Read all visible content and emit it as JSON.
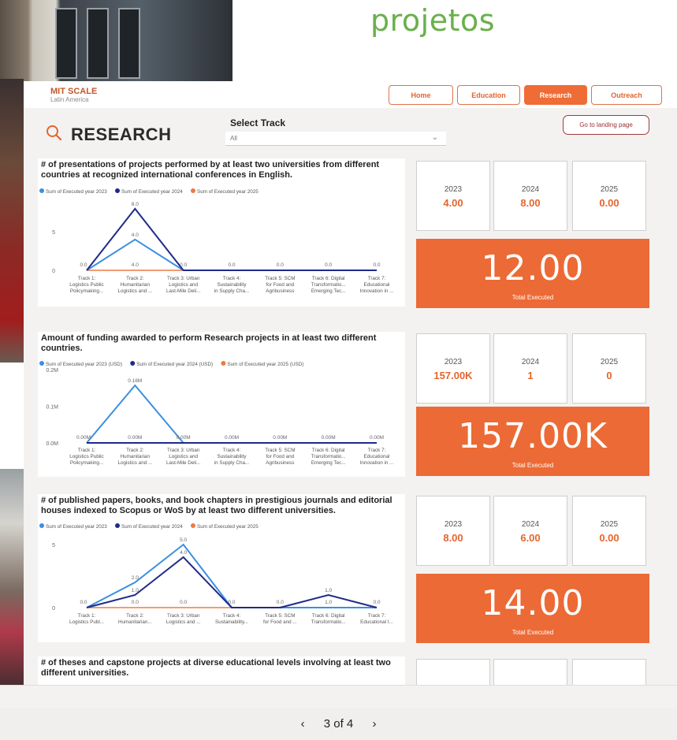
{
  "headline": "projetos",
  "app": {
    "brand_name": "MIT SCALE",
    "brand_sub": "Latin America"
  },
  "nav": {
    "tabs": [
      {
        "label": "Home",
        "active": false
      },
      {
        "label": "Education",
        "active": false
      },
      {
        "label": "Research",
        "active": true
      },
      {
        "label": "Outreach",
        "active": false
      }
    ]
  },
  "page": {
    "title": "RESEARCH",
    "track_label": "Select Track",
    "track_value": "All",
    "landing_button": "Go to landing page"
  },
  "colors": {
    "accent": "#ec6a35",
    "series_2023": "#3b8fe0",
    "series_2024": "#1f2a8a",
    "series_2025": "#ef7a45"
  },
  "categories": [
    [
      "Track 1:",
      "Logistics Public",
      "Policymaking..."
    ],
    [
      "Track 2:",
      "Humanitarian",
      "Logistics and ..."
    ],
    [
      "Track 3: Urban",
      "Logistics and",
      "Last-Mile Deli..."
    ],
    [
      "Track 4:",
      "Sustainability",
      "in Supply Cha..."
    ],
    [
      "Track 5: SCM",
      "for Food and",
      "Agribusiness"
    ],
    [
      "Track 6: Digital",
      "Transformatio...",
      "Emerging Tec..."
    ],
    [
      "Track 7:",
      "Educational",
      "Innovation in ..."
    ]
  ],
  "categories_short": [
    [
      "Track 1:",
      "Logistics Publ..."
    ],
    [
      "Track 2:",
      "Humanitarian..."
    ],
    [
      "Track 3: Urban",
      "Logistics and ..."
    ],
    [
      "Track 4:",
      "Sustainability..."
    ],
    [
      "Track 5: SCM",
      "for Food and ..."
    ],
    [
      "Track 6: Digital",
      "Transformatio..."
    ],
    [
      "Track 7:",
      "Educational I..."
    ]
  ],
  "chart_data": [
    {
      "type": "line",
      "title": "# of presentations of projects performed by at least two universities from different countries at recognized international conferences in English.",
      "categories": [
        "Track 1: Logistics Public Policymaking...",
        "Track 2: Humanitarian Logistics and ...",
        "Track 3: Urban Logistics and Last-Mile Deli...",
        "Track 4: Sustainability in Supply Cha...",
        "Track 5: SCM for Food and Agribusiness",
        "Track 6: Digital Transformatio... Emerging Tec...",
        "Track 7: Educational Innovation in ..."
      ],
      "series": [
        {
          "name": "Sum of Executed year 2023",
          "values": [
            0,
            4,
            0,
            0,
            0,
            0,
            0
          ]
        },
        {
          "name": "Sum of Executed year 2024",
          "values": [
            0,
            8,
            0,
            0,
            0,
            0,
            0
          ]
        },
        {
          "name": "Sum of Executed year 2025",
          "values": [
            0,
            0,
            0,
            0,
            0,
            0,
            0
          ]
        }
      ],
      "data_labels": [
        "0.0",
        "4.0",
        "0.0",
        "0.0",
        "0.0",
        "0.0",
        "0.0"
      ],
      "peak_label": "8.0",
      "yticks": [
        "5",
        "0"
      ],
      "ylim": [
        0,
        8.5
      ],
      "years": [
        {
          "year": "2023",
          "value": "4.00"
        },
        {
          "year": "2024",
          "value": "8.00"
        },
        {
          "year": "2025",
          "value": "0.00"
        }
      ],
      "total": "12.00",
      "total_label": "Total Executed"
    },
    {
      "type": "line",
      "title": "Amount of funding awarded to perform Research projects in at least two different countries.",
      "categories": [
        "Track 1: Logistics Public Policymaking...",
        "Track 2: Humanitarian Logistics and ...",
        "Track 3: Urban Logistics and Last-Mile Deli...",
        "Track 4: Sustainability in Supply Cha...",
        "Track 5: SCM for Food and Agribusiness",
        "Track 6: Digital Transformatio... Emerging Tec...",
        "Track 7: Educational Innovation in ..."
      ],
      "series": [
        {
          "name": "Sum of Executed year 2023 (USD)",
          "values": [
            0,
            0.157,
            0,
            0,
            0,
            0,
            0
          ]
        },
        {
          "name": "Sum of Executed year 2024 (USD)",
          "values": [
            0,
            1e-06,
            0,
            0,
            0,
            0,
            0
          ]
        },
        {
          "name": "Sum of Executed year 2025 (USD)",
          "values": [
            0,
            0,
            0,
            0,
            0,
            0,
            0
          ]
        }
      ],
      "data_labels": [
        "0.00M",
        "0.00M",
        "0.00M",
        "0.00M",
        "0.00M",
        "0.00M",
        "0.00M"
      ],
      "peak_label": "0.16M",
      "yticks": [
        "0.2M",
        "0.1M",
        "0.0M"
      ],
      "ylim": [
        0,
        0.2
      ],
      "years": [
        {
          "year": "2023",
          "value": "157.00K"
        },
        {
          "year": "2024",
          "value": "1"
        },
        {
          "year": "2025",
          "value": "0"
        }
      ],
      "total": "157.00K",
      "total_label": "Total Executed"
    },
    {
      "type": "line",
      "title": "# of published papers, books, and book chapters in prestigious journals and editorial houses indexed to Scopus or WoS by at least two different universities.",
      "categories": [
        "Track 1: Logistics Publ...",
        "Track 2: Humanitarian...",
        "Track 3: Urban Logistics and ...",
        "Track 4: Sustainability...",
        "Track 5: SCM for Food and ...",
        "Track 6: Digital Transformatio...",
        "Track 7: Educational I..."
      ],
      "series": [
        {
          "name": "Sum of Executed year 2023",
          "values": [
            0,
            2,
            5,
            0,
            0,
            0,
            0
          ]
        },
        {
          "name": "Sum of Executed year 2024",
          "values": [
            0,
            1,
            4,
            0,
            0,
            1,
            0
          ]
        },
        {
          "name": "Sum of Executed year 2025",
          "values": [
            0,
            0,
            0,
            0,
            0,
            0,
            0
          ]
        }
      ],
      "data_labels": [
        "0.0",
        "0.0",
        "0.0",
        "0.0",
        "0.0",
        "1.0",
        "0.0"
      ],
      "extra_labels": [
        "2.0",
        "1.0",
        "5.0",
        "4.0",
        "1.0"
      ],
      "yticks": [
        "5",
        "0"
      ],
      "ylim": [
        0,
        6
      ],
      "years": [
        {
          "year": "2023",
          "value": "8.00"
        },
        {
          "year": "2024",
          "value": "6.00"
        },
        {
          "year": "2025",
          "value": "0.00"
        }
      ],
      "total": "14.00",
      "total_label": "Total Executed"
    },
    {
      "type": "line",
      "title": "# of theses and capstone projects at diverse educational levels involving at least two different universities."
    }
  ],
  "pager": {
    "prev": "‹",
    "label": "3 of 4",
    "next": "›"
  }
}
